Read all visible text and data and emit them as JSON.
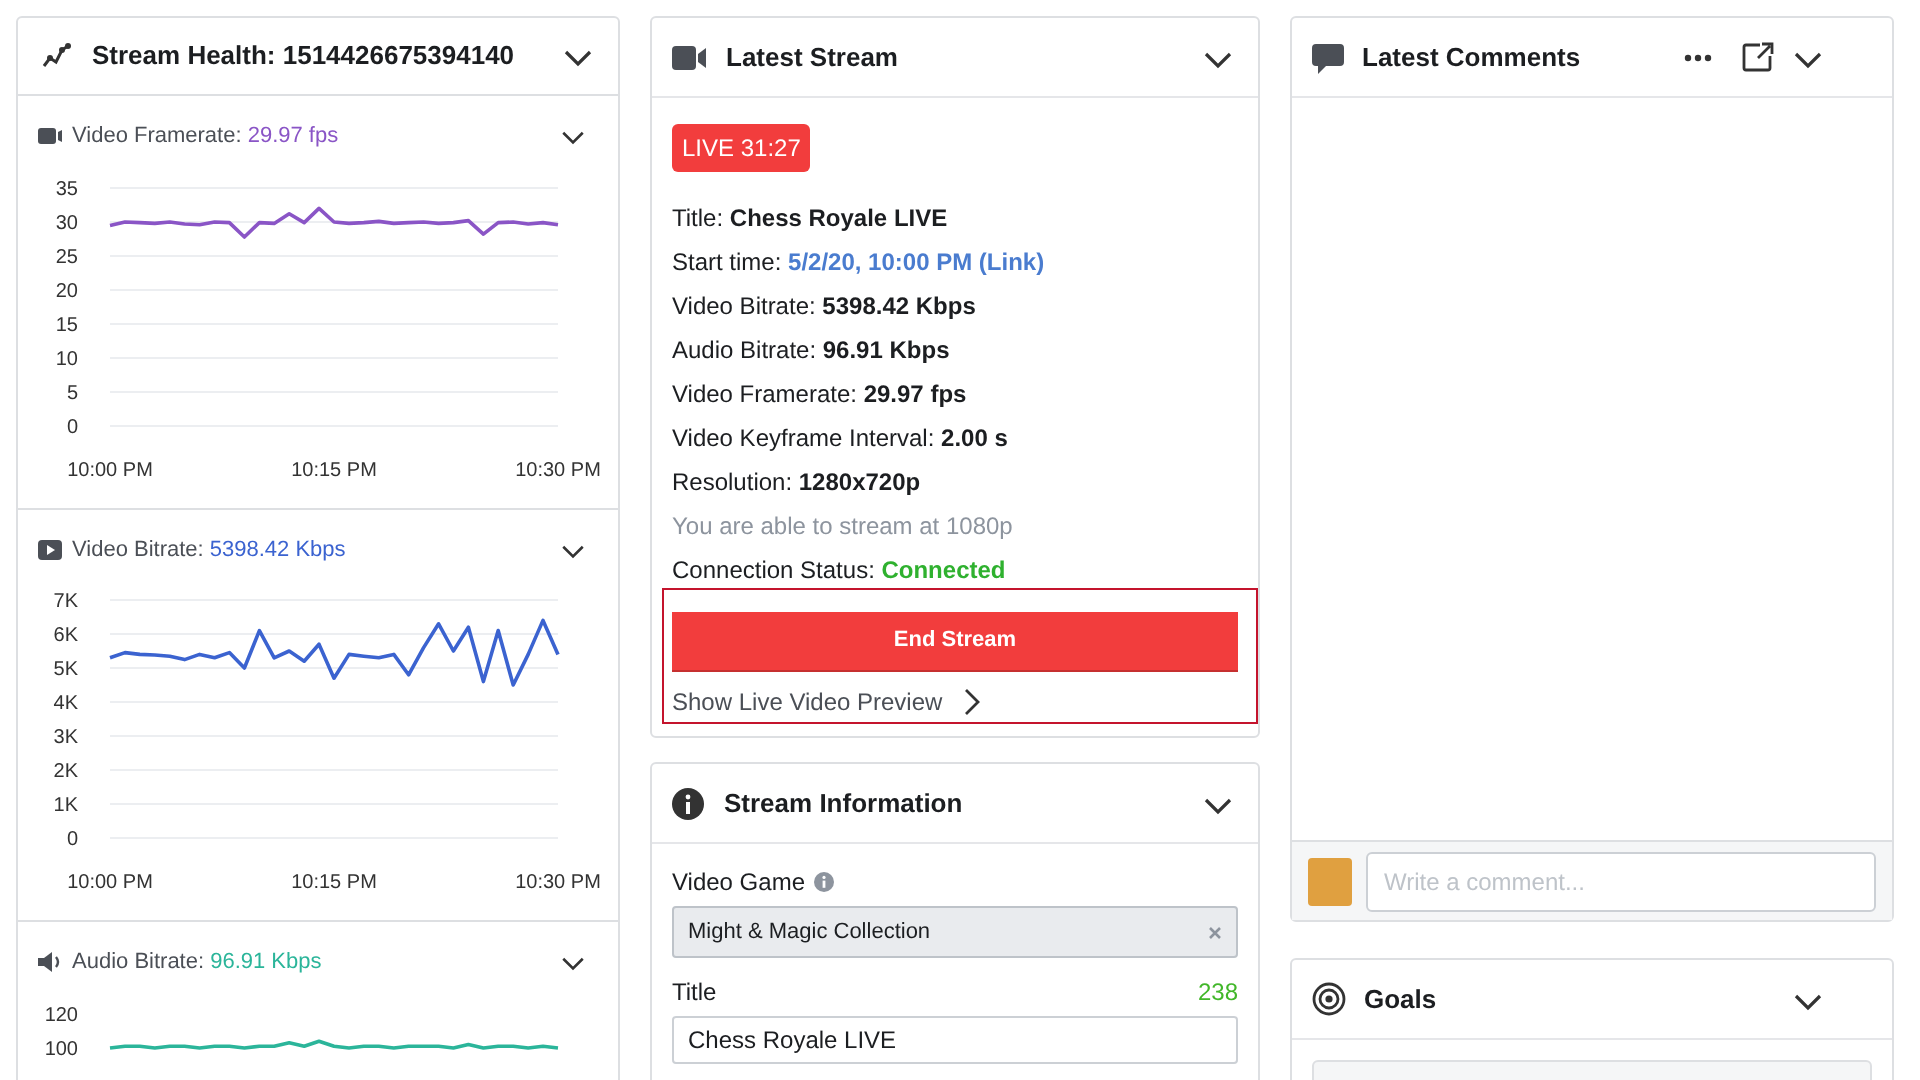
{
  "stream_health": {
    "title": "Stream Health: 1514426675394140",
    "metrics": [
      {
        "kind": "framerate",
        "label": "Video Framerate:",
        "value": "29.97 fps",
        "chart_data": {
          "type": "line",
          "categories": [
            "10:00 PM",
            null,
            null,
            null,
            null,
            null,
            null,
            null,
            null,
            null,
            null,
            null,
            null,
            null,
            null,
            "10:15 PM",
            null,
            null,
            null,
            null,
            null,
            null,
            null,
            null,
            null,
            null,
            null,
            null,
            null,
            null,
            "10:30 PM"
          ],
          "series": [
            {
              "color": "#8a55c6",
              "values": [
                29.5,
                30,
                29.9,
                29.8,
                30,
                29.7,
                29.6,
                30,
                29.9,
                27.8,
                29.9,
                29.8,
                31.2,
                29.9,
                32,
                30,
                29.8,
                29.9,
                30.1,
                29.8,
                29.9,
                30,
                29.8,
                29.9,
                30.2,
                28.2,
                29.9,
                30,
                29.7,
                29.9,
                29.6
              ]
            }
          ],
          "ylim": [
            0,
            35
          ],
          "yticks": [
            0,
            5,
            10,
            15,
            20,
            25,
            30,
            35
          ],
          "grid": true
        }
      },
      {
        "kind": "video_bitrate",
        "label": "Video Bitrate:",
        "value": "5398.42 Kbps",
        "chart_data": {
          "type": "line",
          "categories": [
            "10:00 PM",
            null,
            null,
            null,
            null,
            null,
            null,
            null,
            null,
            null,
            null,
            null,
            null,
            null,
            null,
            "10:15 PM",
            null,
            null,
            null,
            null,
            null,
            null,
            null,
            null,
            null,
            null,
            null,
            null,
            null,
            null,
            "10:30 PM"
          ],
          "series": [
            {
              "color": "#3b63d0",
              "values": [
                5300,
                5450,
                5400,
                5380,
                5350,
                5250,
                5400,
                5300,
                5450,
                5000,
                6100,
                5300,
                5500,
                5200,
                5700,
                4700,
                5400,
                5350,
                5300,
                5400,
                4800,
                5600,
                6300,
                5500,
                6200,
                4600,
                6100,
                4500,
                5400,
                6400,
                5400
              ]
            }
          ],
          "ylim": [
            0,
            7000
          ],
          "yticks": [
            {
              "value": 0,
              "label": "0"
            },
            {
              "value": 1000,
              "label": "1K"
            },
            {
              "value": 2000,
              "label": "2K"
            },
            {
              "value": 3000,
              "label": "3K"
            },
            {
              "value": 4000,
              "label": "4K"
            },
            {
              "value": 5000,
              "label": "5K"
            },
            {
              "value": 6000,
              "label": "6K"
            },
            {
              "value": 7000,
              "label": "7K"
            }
          ],
          "grid": true
        }
      },
      {
        "kind": "audio_bitrate",
        "label": "Audio Bitrate:",
        "value": "96.91 Kbps",
        "chart_data": {
          "type": "line",
          "categories": [
            null,
            null,
            null,
            null,
            null,
            null,
            null,
            null,
            null,
            null,
            null,
            null,
            null,
            null,
            null,
            null,
            null,
            null,
            null,
            null,
            null,
            null,
            null,
            null,
            null,
            null,
            null,
            null,
            null,
            null,
            null
          ],
          "series": [
            {
              "color": "#2bb59a",
              "values": [
                100,
                101,
                101,
                100,
                101,
                101,
                100,
                101,
                101,
                100,
                101,
                101,
                103,
                101,
                104,
                101,
                100,
                101,
                101,
                100,
                101,
                101,
                101,
                100,
                102,
                100,
                101,
                101,
                100,
                101,
                100
              ]
            }
          ],
          "ylim": [
            100,
            120
          ],
          "yticks": [
            100,
            120
          ]
        }
      }
    ]
  },
  "latest_stream": {
    "title": "Latest Stream",
    "live_badge": "LIVE 31:27",
    "details": [
      {
        "kind": "bold",
        "label": "Title:",
        "value": "Chess Royale LIVE"
      },
      {
        "kind": "link",
        "label": "Start time:",
        "value": "5/2/20, 10:00 PM (Link)"
      },
      {
        "kind": "bold",
        "label": "Video Bitrate:",
        "value": "5398.42 Kbps"
      },
      {
        "kind": "bold",
        "label": "Audio Bitrate:",
        "value": "96.91 Kbps"
      },
      {
        "kind": "bold",
        "label": "Video Framerate:",
        "value": "29.97 fps"
      },
      {
        "kind": "bold",
        "label": "Video Keyframe Interval:",
        "value": "2.00 s"
      },
      {
        "kind": "bold",
        "label": "Resolution:",
        "value": "1280x720p"
      },
      {
        "kind": "note",
        "value": "You are able to stream at 1080p"
      },
      {
        "kind": "status",
        "label": "Connection Status:",
        "value": "Connected"
      }
    ],
    "end_button": "End Stream",
    "end_button_highlighted": true,
    "preview_link": "Show Live Video Preview"
  },
  "stream_information": {
    "title": "Stream Information",
    "fields": [
      {
        "kind": "select",
        "label": "Video Game",
        "value": "Might & Magic Collection"
      },
      {
        "kind": "text",
        "label": "Title",
        "counter": "238",
        "value": "Chess Royale LIVE"
      }
    ]
  },
  "latest_comments": {
    "title": "Latest Comments",
    "placeholder": "Write a comment..."
  },
  "goals": {
    "title": "Goals"
  }
}
